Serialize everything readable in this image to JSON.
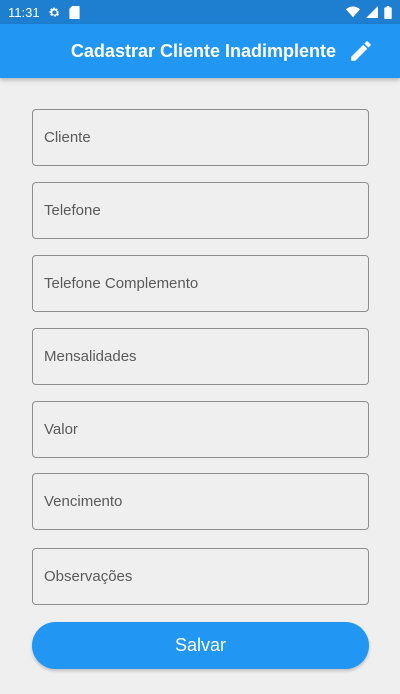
{
  "status_bar": {
    "time": "11:31",
    "icons": [
      "settings-icon",
      "sim-card-icon",
      "wifi-icon",
      "signal-icon",
      "battery-icon"
    ]
  },
  "app_bar": {
    "title": "Cadastrar Cliente Inadimplente",
    "action_icon": "edit-icon",
    "color": "#2196f3"
  },
  "form": {
    "fields": [
      {
        "label": "Cliente",
        "value": ""
      },
      {
        "label": "Telefone",
        "value": ""
      },
      {
        "label": "Telefone Complemento",
        "value": ""
      },
      {
        "label": "Mensalidades",
        "value": ""
      },
      {
        "label": "Valor",
        "value": ""
      },
      {
        "label": "Vencimento",
        "value": ""
      },
      {
        "label": "Observações",
        "value": ""
      }
    ],
    "submit_label": "Salvar"
  }
}
